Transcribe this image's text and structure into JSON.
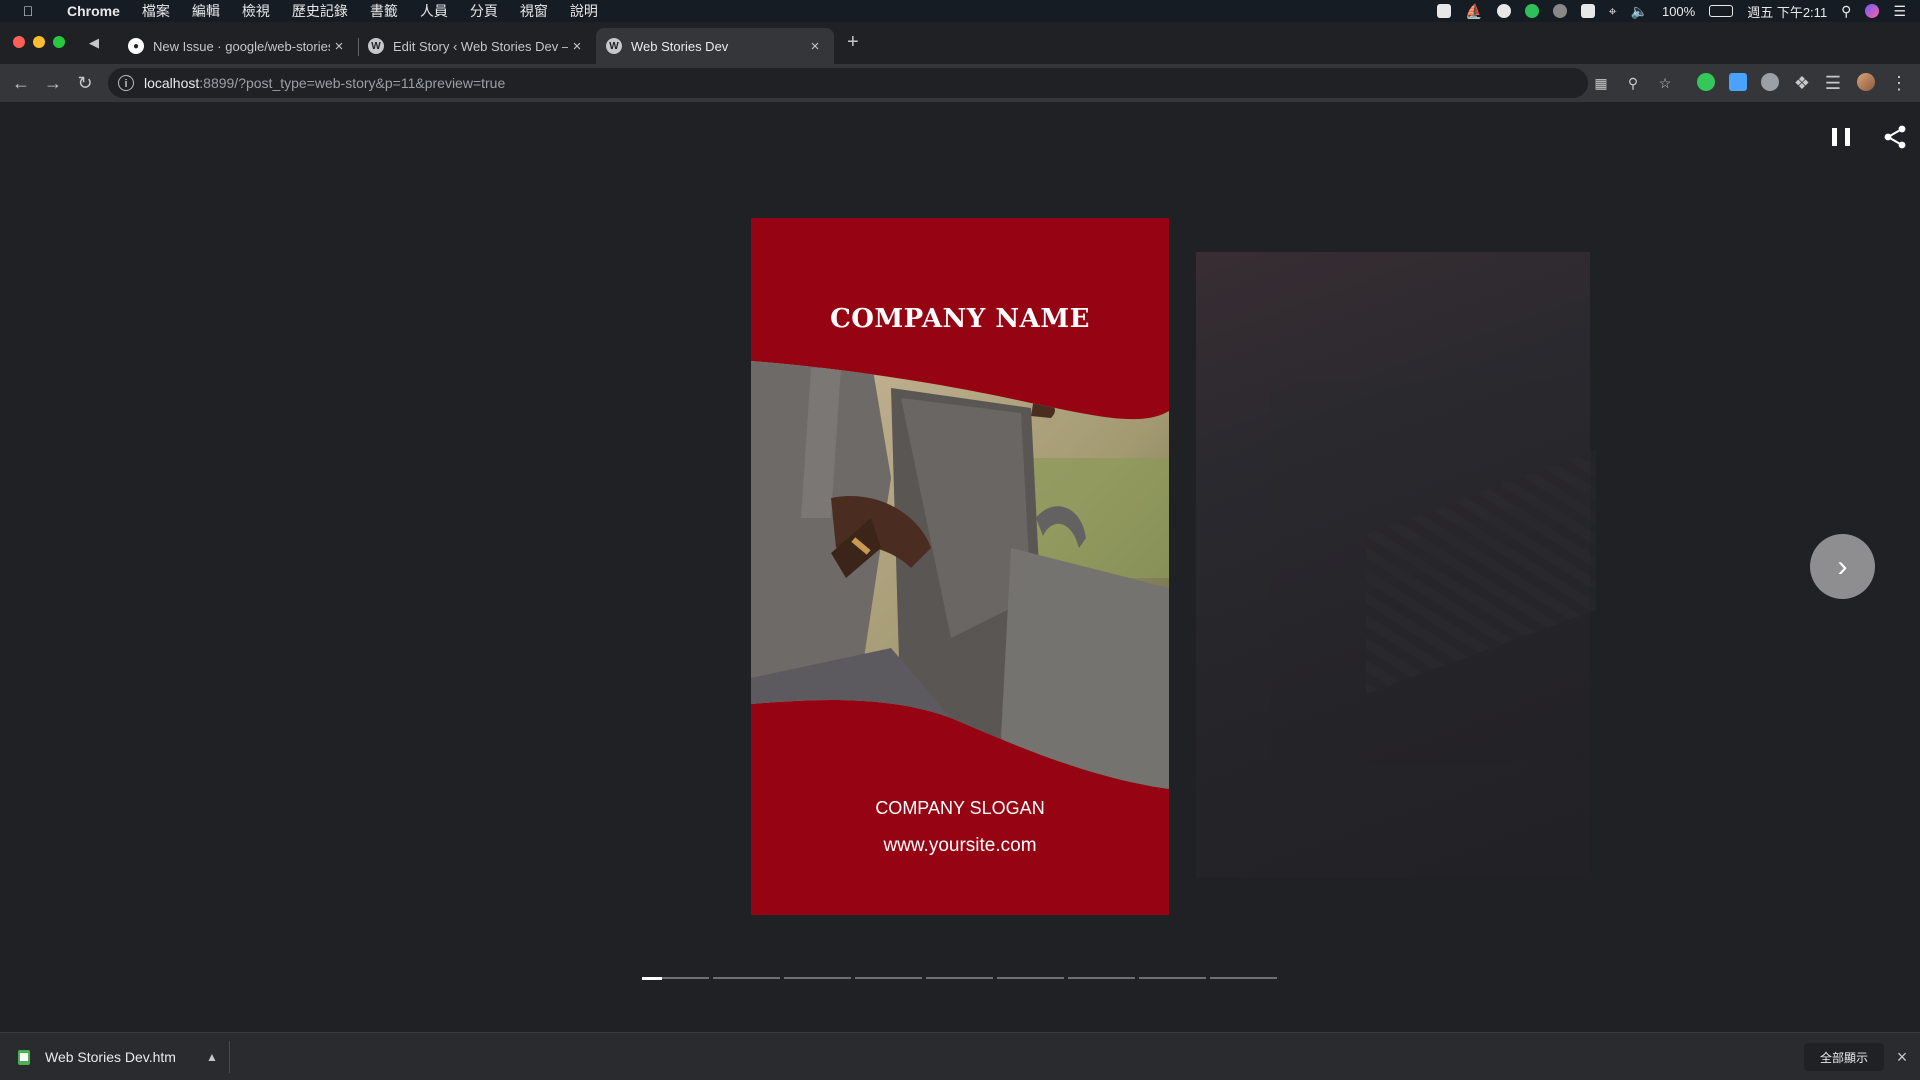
{
  "menubar": {
    "app": "Chrome",
    "items": [
      "檔案",
      "編輯",
      "檢視",
      "歷史記錄",
      "書籤",
      "人員",
      "分頁",
      "視窗",
      "說明"
    ],
    "battery": "100%",
    "clock": "週五 下午2:11"
  },
  "tabs": [
    {
      "title": "New Issue · google/web-stories-wp",
      "icon": "github-icon"
    },
    {
      "title": "Edit Story ‹ Web Stories Dev — WordPress",
      "icon": "wordpress-icon"
    },
    {
      "title": "Web Stories Dev",
      "icon": "wordpress-icon",
      "active": true
    }
  ],
  "toolbar": {
    "url_host": "localhost",
    "url_rest": ":8899/?post_type=web-story&p=11&preview=true"
  },
  "story": {
    "company_name": "COMPANY NAME",
    "slogan": "COMPANY SLOGAN",
    "website": "www.yoursite.com",
    "page_count": 9,
    "current_page": 1,
    "current_page_progress": 0.3,
    "brand_color": "#960413"
  },
  "downloads": {
    "file_name": "Web Stories Dev.htm",
    "show_all": "全部顯示"
  }
}
